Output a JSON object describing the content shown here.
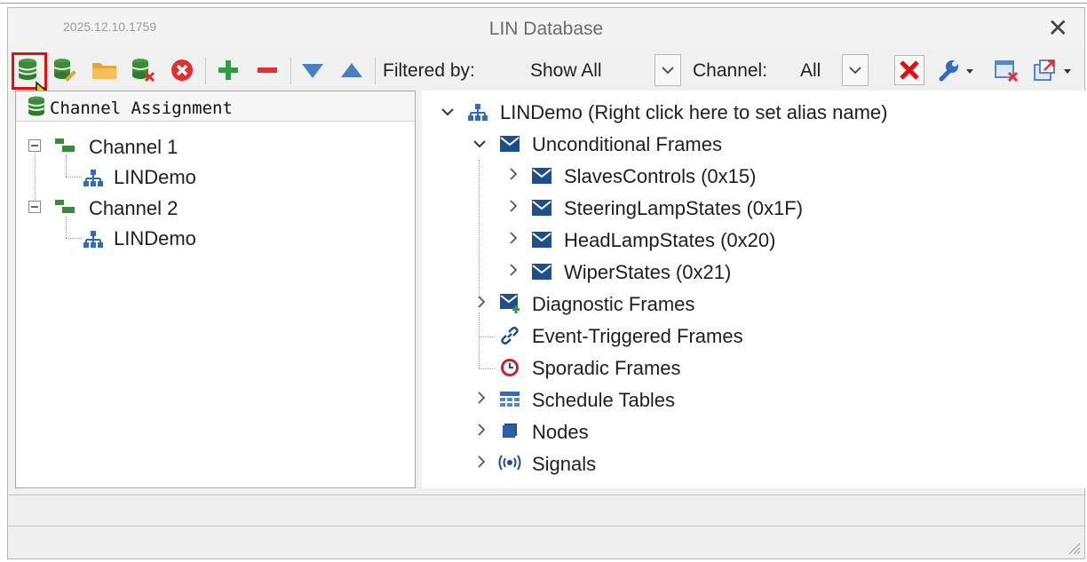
{
  "window": {
    "version": "2025.12.10.1759",
    "title": "LIN Database",
    "close_glyph": "✕"
  },
  "toolbar": {
    "buttons": [
      {
        "name": "database-assign-icon",
        "color": "#3a8a3a"
      },
      {
        "name": "database-edit-icon",
        "color": "#3a8a3a"
      },
      {
        "name": "folder-open-icon",
        "color": "#e3a43a"
      },
      {
        "name": "database-remove-icon",
        "color": "#3a8a3a"
      },
      {
        "name": "close-circle-icon",
        "color": "#e03131"
      },
      {
        "name": "plus-icon",
        "color": "#2e9e44"
      },
      {
        "name": "minus-icon",
        "color": "#e03131"
      },
      {
        "name": "arrow-down-icon",
        "color": "#4a7fbf"
      },
      {
        "name": "arrow-up-icon",
        "color": "#4a7fbf"
      }
    ],
    "filter_label": "Filtered by:",
    "filter_value": "Show All",
    "channel_label": "Channel:",
    "channel_value": "All"
  },
  "left_panel": {
    "header": "Channel Assignment",
    "tree": [
      {
        "label": "Channel 1",
        "children": [
          "LINDemo"
        ]
      },
      {
        "label": "Channel 2",
        "children": [
          "LINDemo"
        ]
      }
    ]
  },
  "right_panel": {
    "root": "LINDemo (Right click here to set alias name)",
    "unconditional": "Unconditional Frames",
    "frames": [
      "SlavesControls (0x15)",
      "SteeringLampStates (0x1F)",
      "HeadLampStates (0x20)",
      "WiperStates (0x21)"
    ],
    "diagnostic": "Diagnostic Frames",
    "event_triggered": "Event-Triggered Frames",
    "sporadic": "Sporadic Frames",
    "schedule": "Schedule Tables",
    "nodes": "Nodes",
    "signals": "Signals"
  },
  "colors": {
    "accent_blue": "#1f4e8c",
    "tree_green": "#3a8a3a",
    "highlight_red": "#e01010"
  }
}
